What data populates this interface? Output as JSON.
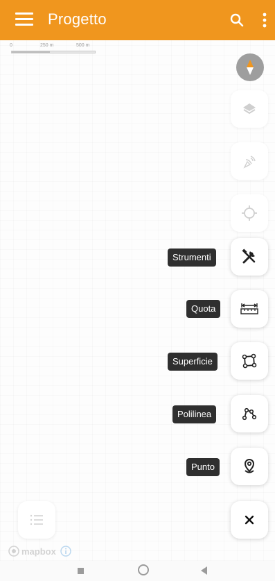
{
  "appbar": {
    "title": "Progetto",
    "color": "#f0961e",
    "menu_icon": "hamburger-menu-icon",
    "search_icon": "search-icon",
    "more_icon": "more-vert-icon"
  },
  "map": {
    "scale": {
      "zero": "0",
      "mid": "250 m",
      "end": "500 m"
    },
    "attribution": "mapbox"
  },
  "controls": {
    "compass_icon": "compass-icon",
    "layers_icon": "layers-icon",
    "gps_icon": "satellite-dish-icon",
    "locate_icon": "crosshair-icon"
  },
  "actions": [
    {
      "label": "Strumenti",
      "icon": "tools-icon"
    },
    {
      "label": "Quota",
      "icon": "ruler-icon"
    },
    {
      "label": "Superficie",
      "icon": "polygon-icon"
    },
    {
      "label": "Polilinea",
      "icon": "polyline-icon"
    },
    {
      "label": "Punto",
      "icon": "map-pin-icon"
    }
  ],
  "close_icon": "close-icon",
  "list_icon": "list-icon"
}
